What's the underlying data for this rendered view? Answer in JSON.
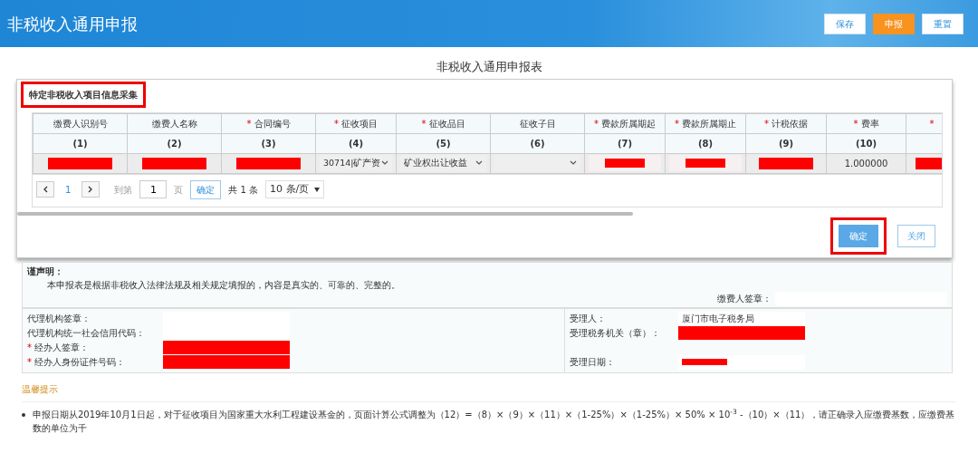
{
  "header": {
    "title": "非税收入通用申报",
    "buttons": [
      {
        "label": "保存",
        "kind": "plain"
      },
      {
        "label": "申报",
        "kind": "primary"
      },
      {
        "label": "重置",
        "kind": "plain"
      }
    ]
  },
  "form_title": "非税收入通用申报表",
  "dialog": {
    "title": "特定非税收入项目信息采集",
    "columns": [
      {
        "label": "缴费人识别号",
        "index": "(1)"
      },
      {
        "label": "缴费人名称",
        "index": "(2)"
      },
      {
        "mark": "*",
        "label": "合同编号",
        "index": "(3)"
      },
      {
        "mark": "*",
        "label": "征收项目",
        "index": "(4)"
      },
      {
        "mark": "*",
        "label": "征收品目",
        "index": "(5)"
      },
      {
        "label": "征收子目",
        "index": "(6)"
      },
      {
        "mark": "*",
        "label": "费款所属期起",
        "index": "(7)"
      },
      {
        "mark": "*",
        "label": "费款所属期止",
        "index": "(8)"
      },
      {
        "mark": "*",
        "label": "计税依据",
        "index": "(9)"
      },
      {
        "mark": "*",
        "label": "费率",
        "index": "(10)"
      },
      {
        "mark": "*"
      }
    ],
    "row": [
      {
        "kind": "redacted"
      },
      {
        "kind": "redacted"
      },
      {
        "kind": "redacted"
      },
      {
        "kind": "select",
        "value": "30714|矿产资"
      },
      {
        "kind": "select",
        "value": "矿业权出让收益"
      },
      {
        "kind": "select"
      },
      {
        "kind": "input-redacted"
      },
      {
        "kind": "input-redacted"
      },
      {
        "kind": "redacted"
      },
      {
        "kind": "text",
        "value": "1.000000"
      },
      {
        "kind": "redacted"
      }
    ],
    "pagination": {
      "current_page": "1",
      "goto_label": "到第",
      "page_value": "1",
      "page_unit": "页",
      "confirm": "确定",
      "total": "共 1 条",
      "page_size": "10 条/页"
    },
    "buttons": [
      {
        "label": "确定",
        "kind": "primary"
      },
      {
        "label": "关闭",
        "kind": "plain"
      }
    ]
  },
  "declaration": {
    "heading": "谨声明：",
    "text": "本申报表是根据非税收入法律法规及相关规定填报的，内容是真实的、可靠的、完整的。",
    "signature_label": "缴费人签章："
  },
  "agent": {
    "left": [
      {
        "label": "代理机构签章：",
        "kind": "blank"
      },
      {
        "label": "代理机构统一社会信用代码：",
        "kind": "blank"
      },
      {
        "mark": "*",
        "label": "经办人签章：",
        "kind": "redacted"
      },
      {
        "mark": "*",
        "label": "经办人身份证件号码：",
        "kind": "redacted"
      }
    ],
    "right": [
      {
        "label": "受理人：",
        "kind": "text",
        "value": "厦门市电子税务局"
      },
      {
        "label": "受理税务机关（章）：",
        "kind": "redacted"
      },
      {
        "kind": "spacer"
      },
      {
        "label": "受理日期：",
        "kind": "redacted-short"
      }
    ]
  },
  "tips": {
    "title": "温馨提示",
    "items": [
      "申报日期从2019年10月1日起，对于征收项目为国家重大水利工程建设基金的，页面计算公式调整为（12）=（8）×（9）×（11）×（1-25%）×（1-25%）× 50% × 10$^{-3}$ -（10）×（11），请正确录入应缴费基数，应缴费基数的单位为千"
    ]
  }
}
